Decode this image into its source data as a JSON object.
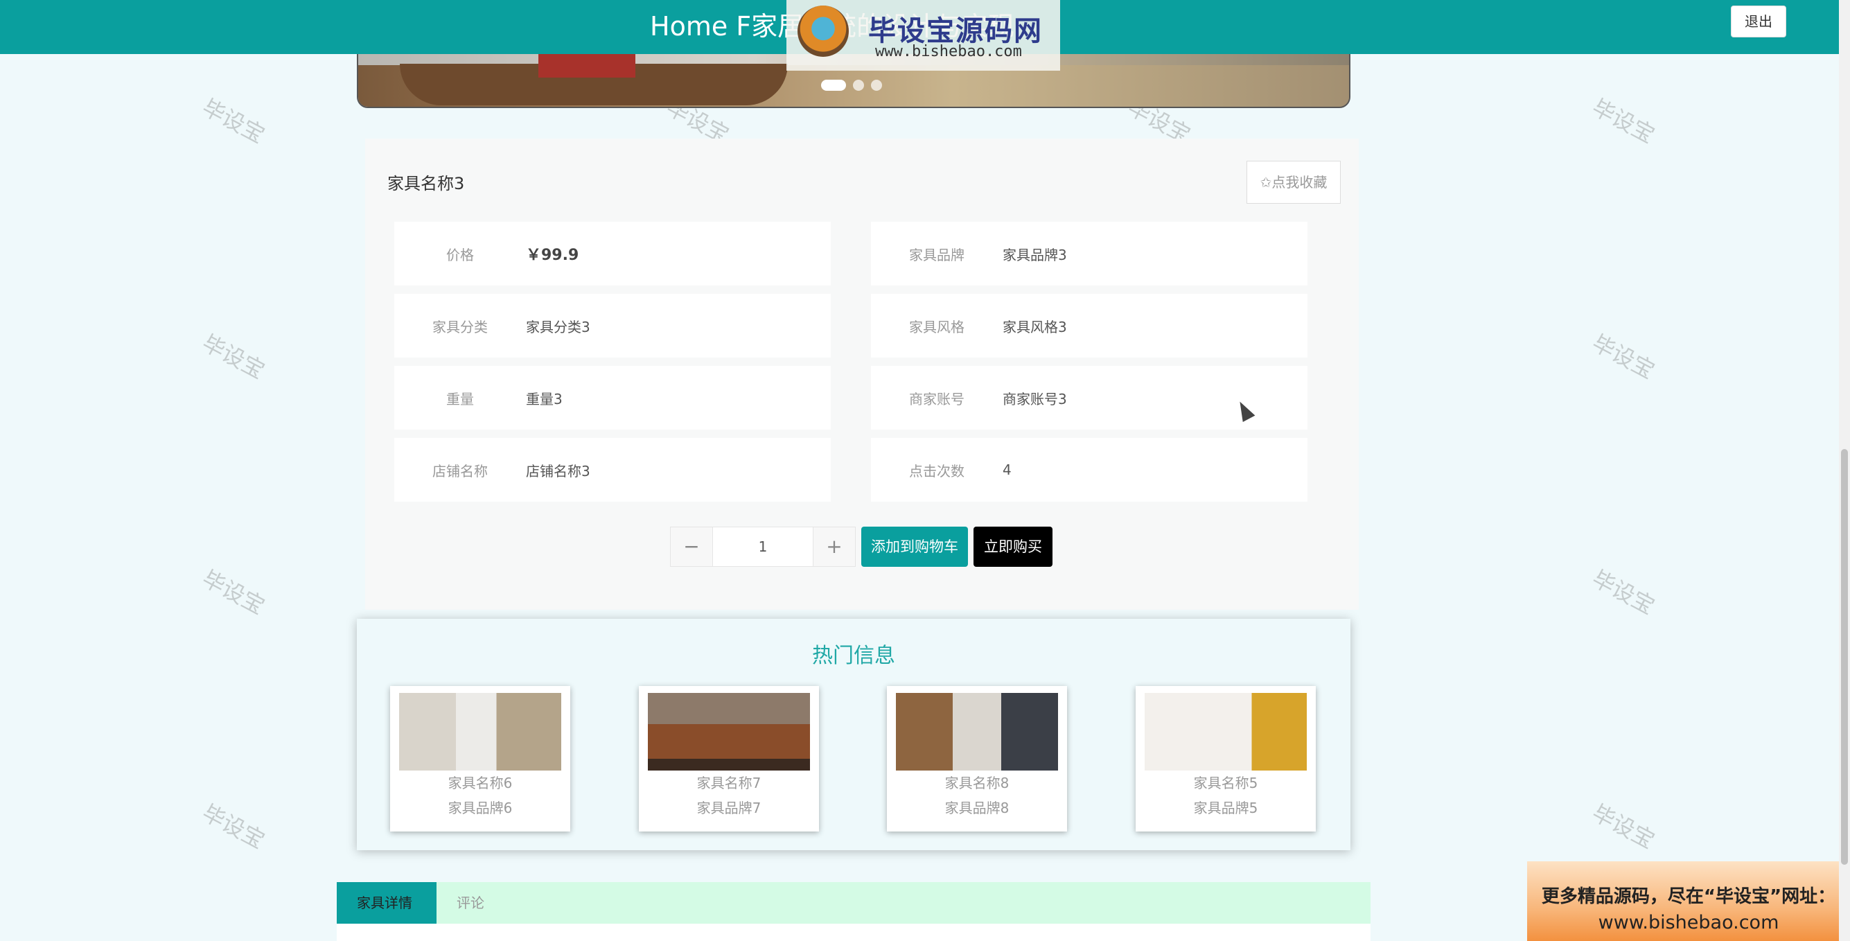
{
  "header": {
    "title": "Home F家居系统的设计与实现",
    "logout_label": "退出"
  },
  "brandmark": {
    "name": "毕设宝源码网",
    "url": "www.bishebao.com"
  },
  "product": {
    "name": "家具名称3",
    "favorite_label": "✩点我收藏",
    "fields": [
      {
        "label": "价格",
        "value": "￥99.9"
      },
      {
        "label": "家具品牌",
        "value": "家具品牌3"
      },
      {
        "label": "家具分类",
        "value": "家具分类3"
      },
      {
        "label": "家具风格",
        "value": "家具风格3"
      },
      {
        "label": "重量",
        "value": "重量3"
      },
      {
        "label": "商家账号",
        "value": "商家账号3"
      },
      {
        "label": "店铺名称",
        "value": "店铺名称3"
      },
      {
        "label": "点击次数",
        "value": "4"
      }
    ],
    "quantity": "1",
    "minus_label": "−",
    "plus_label": "+",
    "add_to_cart_label": "添加到购物车",
    "buy_now_label": "立即购买"
  },
  "hot": {
    "title": "热门信息",
    "items": [
      {
        "name": "家具名称6",
        "brand": "家具品牌6"
      },
      {
        "name": "家具名称7",
        "brand": "家具品牌7"
      },
      {
        "name": "家具名称8",
        "brand": "家具品牌8"
      },
      {
        "name": "家具名称5",
        "brand": "家具品牌5"
      }
    ]
  },
  "tabs": {
    "detail_label": "家具详情",
    "comment_label": "评论"
  },
  "watermark": {
    "text": "毕设宝"
  },
  "promo": {
    "line1": "更多精品源码，尽在“毕设宝”网址：",
    "line2": "www.bishebao.com"
  }
}
